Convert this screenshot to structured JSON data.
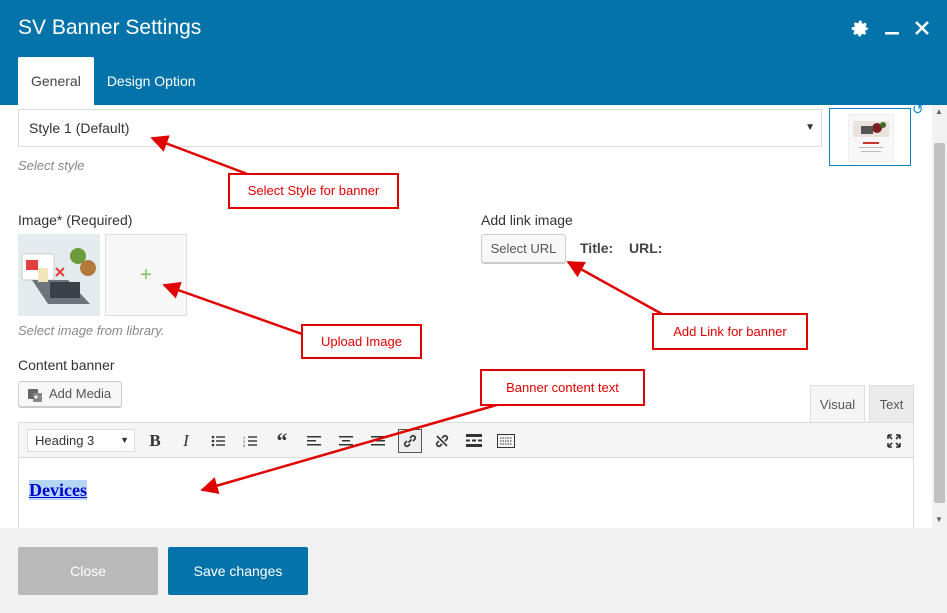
{
  "window": {
    "title": "SV Banner Settings"
  },
  "tabs": [
    {
      "label": "General"
    },
    {
      "label": "Design Option"
    }
  ],
  "general": {
    "style_select": {
      "value": "Style 1 (Default)",
      "hint": "Select style"
    },
    "image": {
      "label": "Image* (Required)",
      "hint": "Select image from library."
    },
    "link": {
      "label": "Add link image",
      "button": "Select URL",
      "title_label": "Title:",
      "url_label": "URL:"
    },
    "content": {
      "label": "Content banner",
      "add_media": "Add Media",
      "editor_tabs": [
        "Visual",
        "Text"
      ],
      "format": "Heading 3",
      "text": "Devices"
    }
  },
  "footer": {
    "close": "Close",
    "save": "Save changes"
  },
  "annotations": {
    "style": "Select Style for banner",
    "upload": "Upload Image",
    "link": "Add Link for banner",
    "content": "Banner content text"
  },
  "colors": {
    "primary": "#0473aa",
    "annotation": "#e00000",
    "disabled": "#b9b9b9"
  },
  "icons": [
    "gear-icon",
    "minimize-icon",
    "close-icon",
    "plus-icon",
    "add-media-icon",
    "refresh-icon"
  ]
}
